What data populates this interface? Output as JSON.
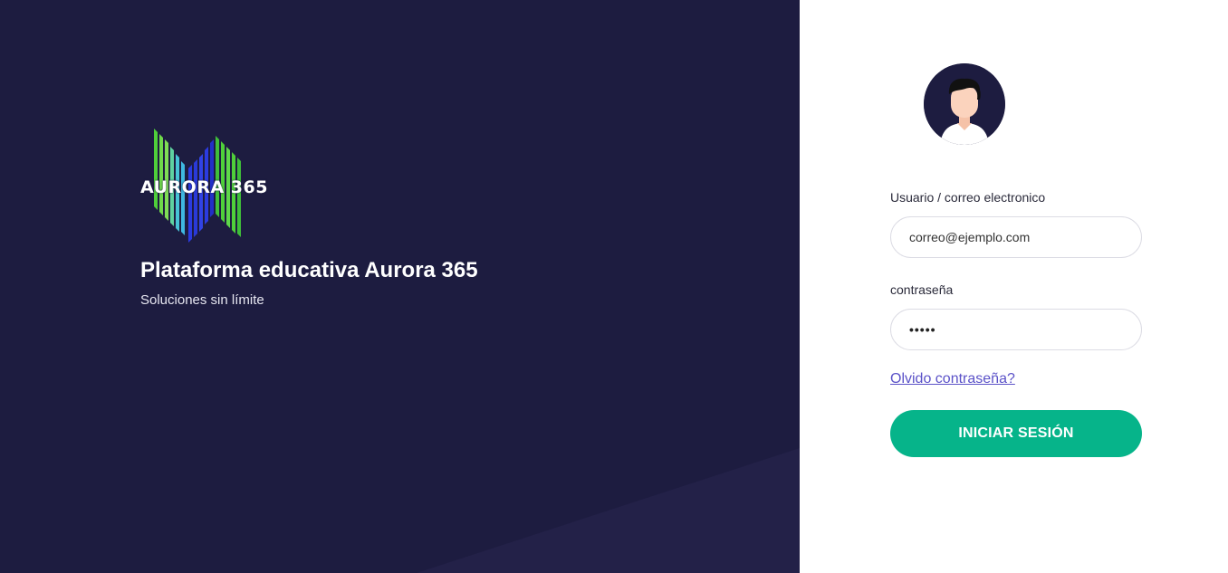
{
  "branding": {
    "logo_text": "AURORA 365",
    "title": "Plataforma educativa Aurora 365",
    "subtitle": "Soluciones sin límite"
  },
  "login_form": {
    "avatar_icon": "user-avatar-icon",
    "email_label": "Usuario / correo electronico",
    "email_placeholder": "correo@ejemplo.com",
    "password_label": "contraseña",
    "password_value": "•••••",
    "forgot_password_link": "Olvido contraseña?",
    "submit_label": "INICIAR SESIÓN"
  },
  "colors": {
    "left_background": "#1d1c40",
    "accent_green": "#06b48a",
    "link_color": "#5b52c8",
    "logo_green": "#4fcf3a",
    "logo_cyan": "#47c4d6",
    "logo_blue": "#2b3be0"
  }
}
